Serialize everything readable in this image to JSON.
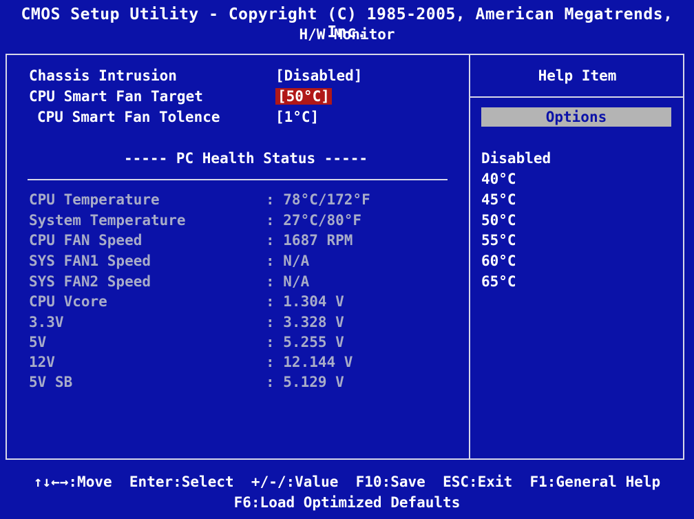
{
  "header": {
    "title": "CMOS Setup Utility - Copyright (C) 1985-2005, American Megatrends, Inc.",
    "subtitle": "H/W Monitor"
  },
  "settings": [
    {
      "label": "Chassis Intrusion",
      "value": "[Disabled]"
    },
    {
      "label": "CPU Smart Fan Target",
      "value": "[50°C]"
    },
    {
      "label": "CPU Smart Fan Tolence",
      "value": "[1°C]"
    }
  ],
  "health": {
    "heading": "----- PC Health Status -----",
    "rows": [
      {
        "label": "CPU Temperature",
        "value": ": 78°C/172°F"
      },
      {
        "label": "System Temperature",
        "value": ": 27°C/80°F"
      },
      {
        "label": "CPU FAN Speed",
        "value": ": 1687 RPM"
      },
      {
        "label": "SYS FAN1 Speed",
        "value": ": N/A"
      },
      {
        "label": "SYS FAN2 Speed",
        "value": ": N/A"
      },
      {
        "label": "CPU Vcore",
        "value": ": 1.304 V"
      },
      {
        "label": "3.3V",
        "value": ": 3.328 V"
      },
      {
        "label": "5V",
        "value": ": 5.255 V"
      },
      {
        "label": "12V",
        "value": ": 12.144 V"
      },
      {
        "label": "5V SB",
        "value": ": 5.129 V"
      }
    ]
  },
  "help": {
    "title": "Help Item",
    "options_label": "Options",
    "options": [
      "Disabled",
      "40°C",
      "45°C",
      "50°C",
      "55°C",
      "60°C",
      "65°C"
    ]
  },
  "footer": {
    "line1": "↑↓←→:Move  Enter:Select  +/-/:Value  F10:Save  ESC:Exit  F1:General Help",
    "line2": "F6:Load Optimized Defaults"
  },
  "colors": {
    "background": "#0b12a8",
    "selected": "#b01818",
    "options_box": "#b4b4b4",
    "dim_text": "#a8acc8"
  }
}
